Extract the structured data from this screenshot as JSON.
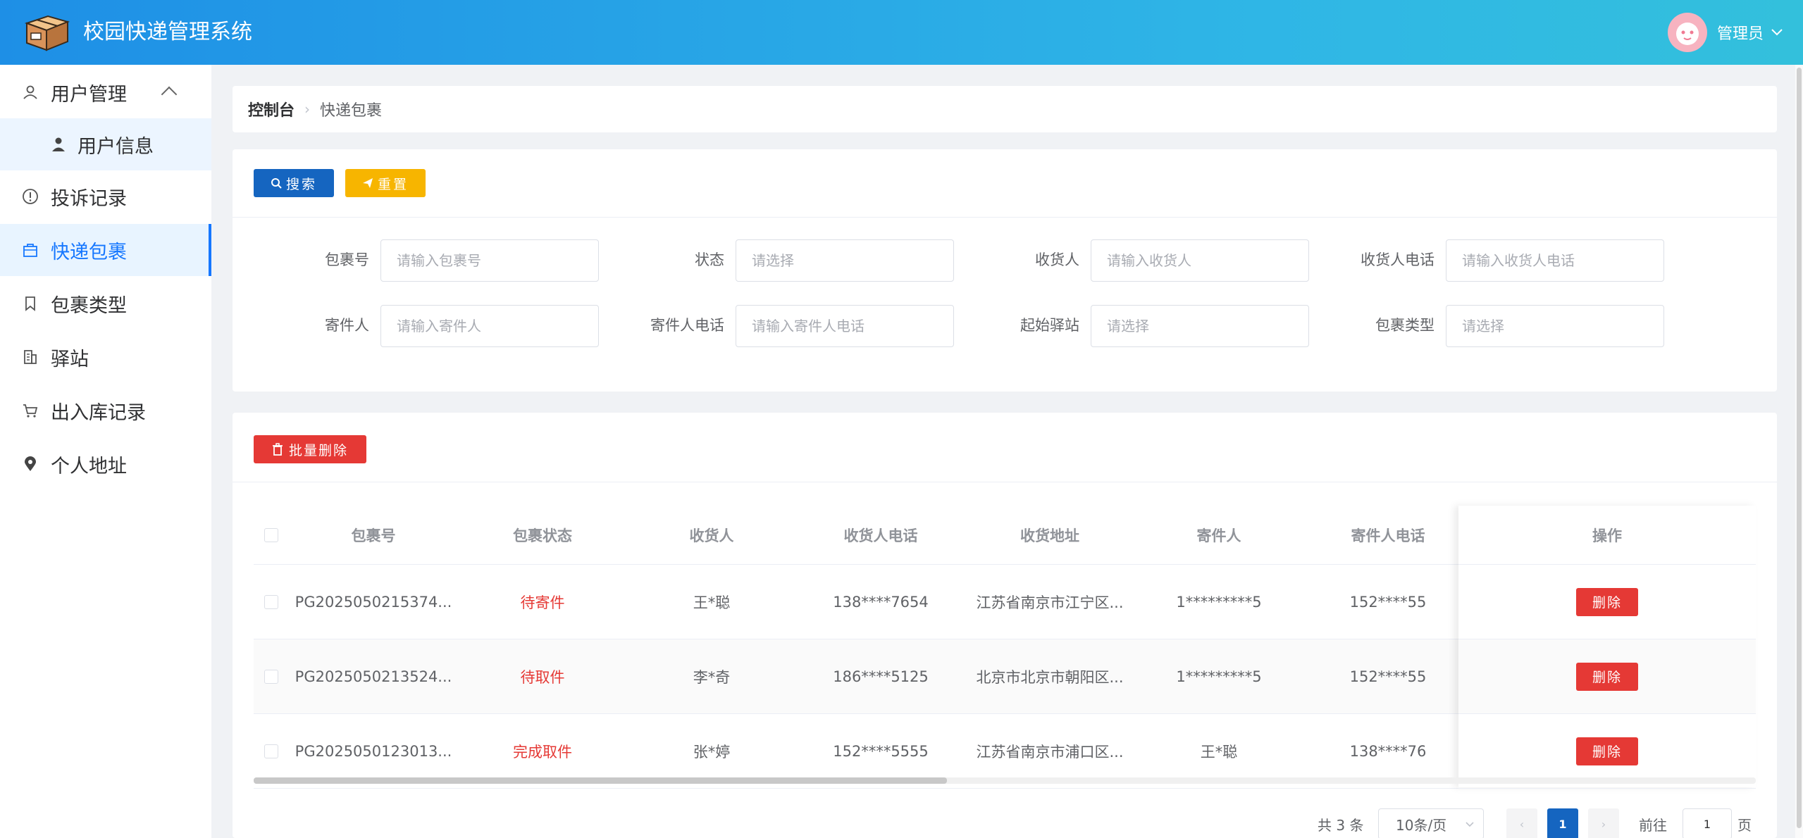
{
  "header": {
    "title": "校园快递管理系统",
    "user": "管理员"
  },
  "sidebar": {
    "items": [
      {
        "label": "用户管理",
        "icon": "user-icon"
      },
      {
        "label": "用户信息",
        "icon": "person-icon"
      },
      {
        "label": "投诉记录",
        "icon": "alert-circle-icon"
      },
      {
        "label": "快递包裹",
        "icon": "package-icon"
      },
      {
        "label": "包裹类型",
        "icon": "bookmark-icon"
      },
      {
        "label": "驿站",
        "icon": "building-icon"
      },
      {
        "label": "出入库记录",
        "icon": "cart-icon"
      },
      {
        "label": "个人地址",
        "icon": "location-icon"
      }
    ]
  },
  "breadcrumb": {
    "home": "控制台",
    "current": "快递包裹"
  },
  "search": {
    "search_label": "搜索",
    "reset_label": "重置",
    "fields": [
      {
        "label": "包裹号",
        "placeholder": "请输入包裹号"
      },
      {
        "label": "状态",
        "placeholder": "请选择"
      },
      {
        "label": "收货人",
        "placeholder": "请输入收货人"
      },
      {
        "label": "收货人电话",
        "placeholder": "请输入收货人电话"
      },
      {
        "label": "寄件人",
        "placeholder": "请输入寄件人"
      },
      {
        "label": "寄件人电话",
        "placeholder": "请输入寄件人电话"
      },
      {
        "label": "起始驿站",
        "placeholder": "请选择"
      },
      {
        "label": "包裹类型",
        "placeholder": "请选择"
      }
    ]
  },
  "table": {
    "batch_delete_label": "批量删除",
    "columns": [
      "包裹号",
      "包裹状态",
      "收货人",
      "收货人电话",
      "收货地址",
      "寄件人",
      "寄件人电话",
      "操作"
    ],
    "rows": [
      {
        "no": "PG2025050215374...",
        "status": "待寄件",
        "receiver": "王*聪",
        "receiver_phone": "138****7654",
        "address": "江苏省南京市江宁区...",
        "sender": "1*********5",
        "sender_phone": "152****55"
      },
      {
        "no": "PG2025050213524...",
        "status": "待取件",
        "receiver": "李*奇",
        "receiver_phone": "186****5125",
        "address": "北京市北京市朝阳区...",
        "sender": "1*********5",
        "sender_phone": "152****55"
      },
      {
        "no": "PG2025050123013...",
        "status": "完成取件",
        "receiver": "张*婷",
        "receiver_phone": "152****5555",
        "address": "江苏省南京市浦口区...",
        "sender": "王*聪",
        "sender_phone": "138****76"
      }
    ],
    "row_delete_label": "删除"
  },
  "pagination": {
    "total": "共 3 条",
    "page_size": "10条/页",
    "current_page": "1",
    "goto_prefix": "前往",
    "goto_value": "1",
    "goto_suffix": "页"
  },
  "colors": {
    "primary": "#1565c0",
    "warning": "#f7b500",
    "danger": "#e53935",
    "header_start": "#1e8fe6",
    "header_end": "#33c0dc"
  }
}
